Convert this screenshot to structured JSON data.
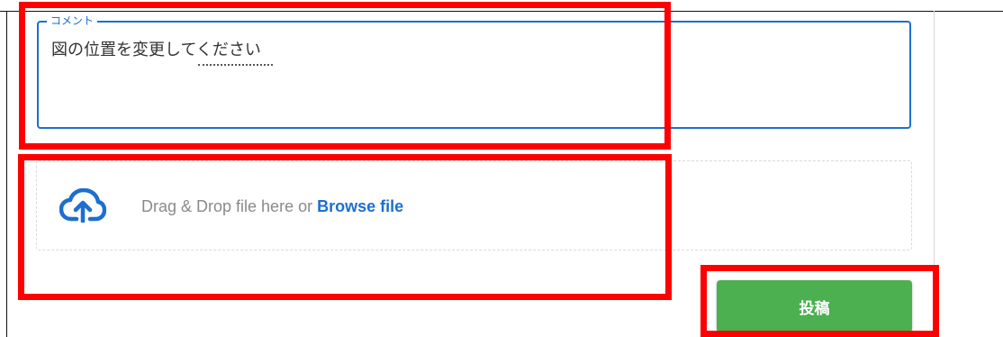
{
  "comment": {
    "legend": "コメント",
    "value": "図の位置を変更してください"
  },
  "upload": {
    "icon": "cloud-upload-icon",
    "prompt_text": "Drag & Drop file here or ",
    "browse_label": "Browse file"
  },
  "actions": {
    "submit_label": "投稿"
  },
  "colors": {
    "accent": "#1c6fd0",
    "submit": "#4caf50",
    "annotation": "#ff0000"
  }
}
